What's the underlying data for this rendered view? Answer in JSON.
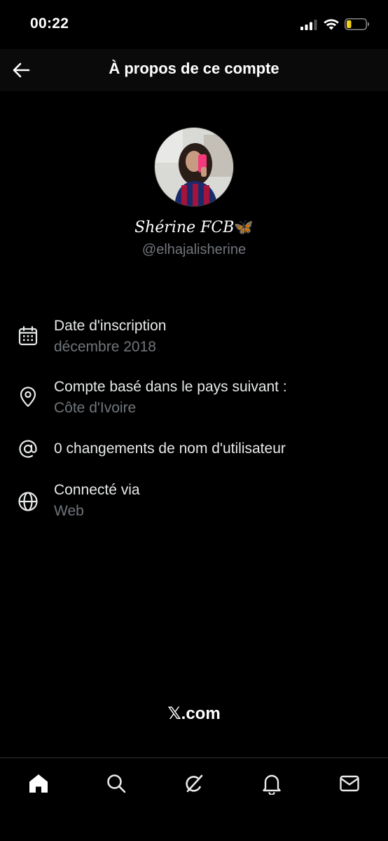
{
  "status_bar": {
    "time": "00:22",
    "battery_level": 0.25
  },
  "header": {
    "title": "À propos de ce compte"
  },
  "profile": {
    "display_name": "Shérine FCB",
    "emoji": "🦋",
    "handle": "@elhajalisherine"
  },
  "info": {
    "joined": {
      "title": "Date d'inscription",
      "value": "décembre 2018"
    },
    "location": {
      "title": "Compte basé dans le pays suivant :",
      "value": "Côte d'Ivoire"
    },
    "username_changes": {
      "title": "0 changements de nom d'utilisateur"
    },
    "connected": {
      "title": "Connecté via",
      "value": "Web"
    }
  },
  "footer": {
    "brand": "𝕏.com"
  },
  "nav": {
    "items": [
      "home-icon",
      "search-icon",
      "grok-icon",
      "notifications-icon",
      "messages-icon"
    ]
  },
  "colors": {
    "background": "#000000",
    "text": "#e7e9ea",
    "muted": "#71767b",
    "accent": "#5fb3e8"
  }
}
